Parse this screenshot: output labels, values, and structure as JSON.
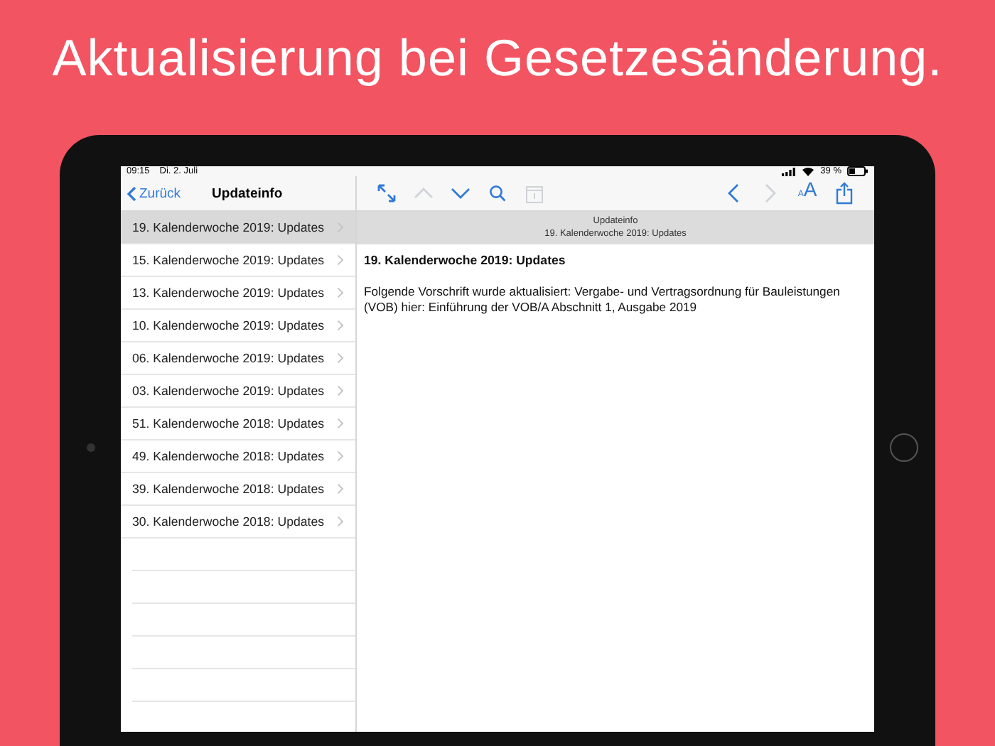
{
  "headline": "Aktualisierung bei Gesetzesänderung.",
  "status_bar": {
    "time": "09:15",
    "date": "Di. 2. Juli",
    "battery": "39 %"
  },
  "nav": {
    "back": "Zurück",
    "title": "Updateinfo"
  },
  "toolbar": [
    {
      "kind": "expand",
      "disabled": false
    },
    {
      "kind": "up",
      "disabled": true
    },
    {
      "kind": "down",
      "disabled": false
    },
    {
      "kind": "search",
      "disabled": false
    },
    {
      "kind": "calendar",
      "disabled": true
    }
  ],
  "toolbar_right": [
    {
      "kind": "back",
      "disabled": false
    },
    {
      "kind": "forward",
      "disabled": true
    },
    {
      "kind": "textsize",
      "disabled": false,
      "small": "A",
      "large": "A"
    },
    {
      "kind": "share",
      "disabled": false
    }
  ],
  "list": [
    {
      "label": "19. Kalenderwoche 2019: Updates",
      "selected": true
    },
    {
      "label": "15. Kalenderwoche 2019: Updates",
      "selected": false
    },
    {
      "label": "13. Kalenderwoche 2019: Updates",
      "selected": false
    },
    {
      "label": "10. Kalenderwoche 2019: Updates",
      "selected": false
    },
    {
      "label": "06. Kalenderwoche 2019: Updates",
      "selected": false
    },
    {
      "label": "03. Kalenderwoche 2019: Updates",
      "selected": false
    },
    {
      "label": "51. Kalenderwoche 2018: Updates",
      "selected": false
    },
    {
      "label": "49. Kalenderwoche 2018: Updates",
      "selected": false
    },
    {
      "label": "39. Kalenderwoche 2018: Updates",
      "selected": false
    },
    {
      "label": "30. Kalenderwoche 2018: Updates",
      "selected": false
    }
  ],
  "detail": {
    "header_title": "Updateinfo",
    "header_subtitle": "19. Kalenderwoche 2019: Updates",
    "heading": "19. Kalenderwoche 2019: Updates",
    "body": "Folgende Vorschrift wurde aktualisiert: Vergabe- und Vertragsordnung für Bauleistungen (VOB) hier: Einführung der VOB/A Abschnitt 1, Ausgabe 2019"
  }
}
